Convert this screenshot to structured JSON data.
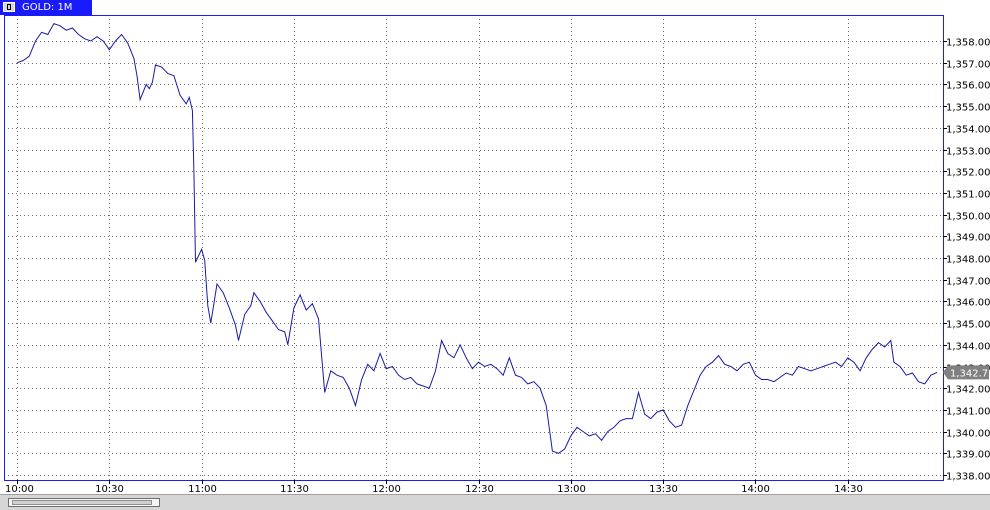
{
  "window": {
    "tab_label": "GOLD: 1M"
  },
  "colors": {
    "line": "#1a1aa8",
    "frame": "#1a1aff",
    "grid": "#707070",
    "badge": "#808080"
  },
  "chart_data": {
    "type": "line",
    "title": "",
    "xlabel": "",
    "ylabel": "",
    "x_ticks": [
      "10:00",
      "10:30",
      "11:00",
      "11:30",
      "12:00",
      "12:30",
      "13:00",
      "13:30",
      "14:00",
      "14:30"
    ],
    "y_ticks": [
      "1,358.00",
      "1,357.00",
      "1,356.00",
      "1,355.00",
      "1,354.00",
      "1,353.00",
      "1,352.00",
      "1,351.00",
      "1,350.00",
      "1,349.00",
      "1,348.00",
      "1,347.00",
      "1,346.00",
      "1,345.00",
      "1,344.00",
      "1,343.00",
      "1,342.00",
      "1,341.00",
      "1,340.00",
      "1,339.00",
      "1,338.00"
    ],
    "ylim": [
      1338,
      1358
    ],
    "xlim_minutes": [
      0,
      299
    ],
    "grid": true,
    "current_price_label": "1,342.73",
    "current_price": 1342.73,
    "series": [
      {
        "values": [
          [
            0,
            1357.0
          ],
          [
            2,
            1357.1
          ],
          [
            4,
            1357.3
          ],
          [
            6,
            1358.0
          ],
          [
            8,
            1358.4
          ],
          [
            10,
            1358.3
          ],
          [
            12,
            1358.8
          ],
          [
            14,
            1358.7
          ],
          [
            16,
            1358.5
          ],
          [
            18,
            1358.6
          ],
          [
            20,
            1358.3
          ],
          [
            22,
            1358.1
          ],
          [
            24,
            1358.0
          ],
          [
            26,
            1358.2
          ],
          [
            28,
            1358.0
          ],
          [
            30,
            1357.6
          ],
          [
            32,
            1358.0
          ],
          [
            34,
            1358.3
          ],
          [
            36,
            1357.9
          ],
          [
            38,
            1357.2
          ],
          [
            39,
            1356.4
          ],
          [
            40,
            1355.3
          ],
          [
            42,
            1356.0
          ],
          [
            43,
            1355.8
          ],
          [
            44,
            1356.1
          ],
          [
            45,
            1356.9
          ],
          [
            47,
            1356.8
          ],
          [
            49,
            1356.5
          ],
          [
            51,
            1356.4
          ],
          [
            53,
            1355.5
          ],
          [
            55,
            1355.1
          ],
          [
            56,
            1355.4
          ],
          [
            57,
            1354.8
          ],
          [
            57.5,
            1352.0
          ],
          [
            58,
            1347.8
          ],
          [
            60,
            1348.4
          ],
          [
            61,
            1347.9
          ],
          [
            62,
            1345.8
          ],
          [
            63,
            1345.0
          ],
          [
            65,
            1346.8
          ],
          [
            67,
            1346.4
          ],
          [
            69,
            1345.7
          ],
          [
            71,
            1344.9
          ],
          [
            72,
            1344.2
          ],
          [
            74,
            1345.4
          ],
          [
            76,
            1345.8
          ],
          [
            77,
            1346.4
          ],
          [
            79,
            1346.0
          ],
          [
            81,
            1345.5
          ],
          [
            83,
            1345.1
          ],
          [
            85,
            1344.7
          ],
          [
            87,
            1344.6
          ],
          [
            88,
            1344.0
          ],
          [
            90,
            1345.7
          ],
          [
            92,
            1346.3
          ],
          [
            94,
            1345.6
          ],
          [
            96,
            1345.9
          ],
          [
            98,
            1345.2
          ],
          [
            99,
            1343.5
          ],
          [
            100,
            1341.8
          ],
          [
            102,
            1342.8
          ],
          [
            104,
            1342.6
          ],
          [
            106,
            1342.5
          ],
          [
            108,
            1342.0
          ],
          [
            110,
            1341.2
          ],
          [
            112,
            1342.4
          ],
          [
            114,
            1343.1
          ],
          [
            116,
            1342.8
          ],
          [
            118,
            1343.6
          ],
          [
            120,
            1342.9
          ],
          [
            122,
            1343.0
          ],
          [
            124,
            1342.6
          ],
          [
            126,
            1342.4
          ],
          [
            128,
            1342.5
          ],
          [
            130,
            1342.2
          ],
          [
            132,
            1342.1
          ],
          [
            134,
            1342.0
          ],
          [
            136,
            1342.8
          ],
          [
            138,
            1344.2
          ],
          [
            140,
            1343.6
          ],
          [
            142,
            1343.4
          ],
          [
            144,
            1344.0
          ],
          [
            146,
            1343.4
          ],
          [
            148,
            1342.9
          ],
          [
            150,
            1343.2
          ],
          [
            152,
            1343.0
          ],
          [
            154,
            1343.1
          ],
          [
            156,
            1342.9
          ],
          [
            158,
            1342.6
          ],
          [
            160,
            1343.4
          ],
          [
            162,
            1342.6
          ],
          [
            164,
            1342.5
          ],
          [
            166,
            1342.2
          ],
          [
            168,
            1342.3
          ],
          [
            170,
            1342.0
          ],
          [
            172,
            1341.2
          ],
          [
            174,
            1339.1
          ],
          [
            176,
            1339.0
          ],
          [
            178,
            1339.2
          ],
          [
            180,
            1339.8
          ],
          [
            182,
            1340.2
          ],
          [
            184,
            1340.0
          ],
          [
            186,
            1339.8
          ],
          [
            188,
            1339.9
          ],
          [
            190,
            1339.6
          ],
          [
            192,
            1340.0
          ],
          [
            194,
            1340.2
          ],
          [
            196,
            1340.5
          ],
          [
            198,
            1340.6
          ],
          [
            200,
            1340.6
          ],
          [
            202,
            1341.8
          ],
          [
            204,
            1340.8
          ],
          [
            206,
            1340.6
          ],
          [
            208,
            1340.9
          ],
          [
            210,
            1341.0
          ],
          [
            212,
            1340.5
          ],
          [
            214,
            1340.2
          ],
          [
            216,
            1340.3
          ],
          [
            218,
            1341.2
          ],
          [
            220,
            1341.9
          ],
          [
            222,
            1342.6
          ],
          [
            224,
            1343.0
          ],
          [
            226,
            1343.2
          ],
          [
            228,
            1343.5
          ],
          [
            230,
            1343.1
          ],
          [
            232,
            1343.0
          ],
          [
            234,
            1342.8
          ],
          [
            236,
            1343.1
          ],
          [
            238,
            1343.2
          ],
          [
            240,
            1342.6
          ],
          [
            242,
            1342.4
          ],
          [
            244,
            1342.4
          ],
          [
            246,
            1342.3
          ],
          [
            248,
            1342.5
          ],
          [
            250,
            1342.7
          ],
          [
            252,
            1342.6
          ],
          [
            254,
            1343.0
          ],
          [
            256,
            1342.9
          ],
          [
            258,
            1342.8
          ],
          [
            260,
            1342.9
          ],
          [
            262,
            1343.0
          ],
          [
            264,
            1343.1
          ],
          [
            266,
            1343.2
          ],
          [
            268,
            1343.0
          ],
          [
            270,
            1343.4
          ],
          [
            272,
            1343.2
          ],
          [
            274,
            1342.8
          ],
          [
            276,
            1343.4
          ],
          [
            278,
            1343.8
          ],
          [
            280,
            1344.1
          ],
          [
            282,
            1343.9
          ],
          [
            284,
            1344.2
          ],
          [
            285,
            1343.2
          ],
          [
            287,
            1343.0
          ],
          [
            289,
            1342.6
          ],
          [
            291,
            1342.7
          ],
          [
            293,
            1342.3
          ],
          [
            295,
            1342.2
          ],
          [
            297,
            1342.6
          ],
          [
            299,
            1342.73
          ]
        ]
      }
    ]
  }
}
